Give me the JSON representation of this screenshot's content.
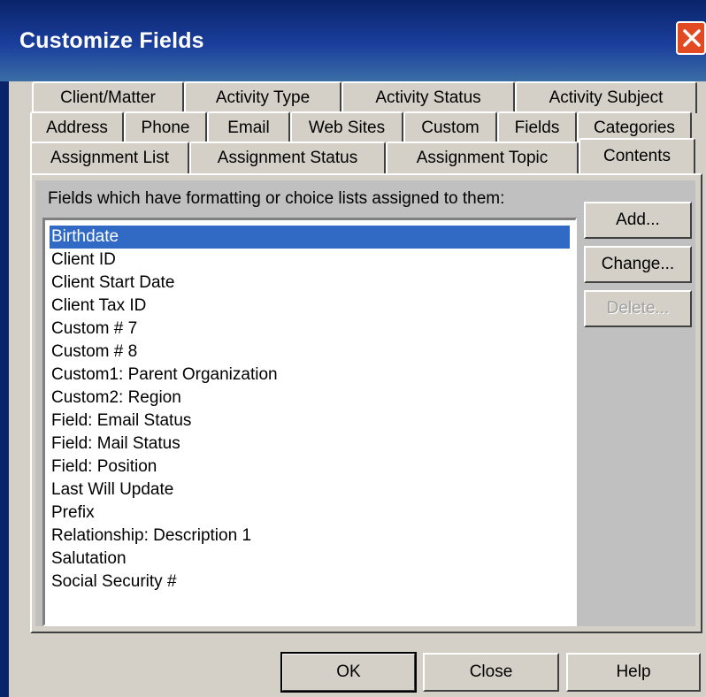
{
  "window": {
    "title": "Customize Fields"
  },
  "tabs": {
    "row1": [
      "Client/Matter",
      "Activity Type",
      "Activity Status",
      "Activity Subject"
    ],
    "row2": [
      "Address",
      "Phone",
      "Email",
      "Web Sites",
      "Custom",
      "Fields",
      "Categories"
    ],
    "row3": [
      "Assignment List",
      "Assignment Status",
      "Assignment Topic",
      "Contents"
    ],
    "active": "Contents"
  },
  "main": {
    "list_label": "Fields which have formatting or choice lists assigned to them:",
    "selected_item": "Birthdate",
    "items": [
      "Birthdate",
      "Client ID",
      "Client Start Date",
      "Client Tax ID",
      "Custom # 7",
      "Custom # 8",
      "Custom1: Parent Organization",
      "Custom2: Region",
      "Field: Email Status",
      "Field: Mail Status",
      "Field: Position",
      "Last Will Update",
      "Prefix",
      "Relationship: Description 1",
      "Salutation",
      "Social Security #"
    ],
    "buttons": {
      "add": "Add...",
      "change": "Change...",
      "delete": "Delete..."
    }
  },
  "footer": {
    "ok": "OK",
    "close": "Close",
    "help": "Help"
  },
  "colors": {
    "titlebar": "#0a246a",
    "selection": "#316ac5",
    "close_button": "#e24a24",
    "face": "#d4d0c8"
  }
}
